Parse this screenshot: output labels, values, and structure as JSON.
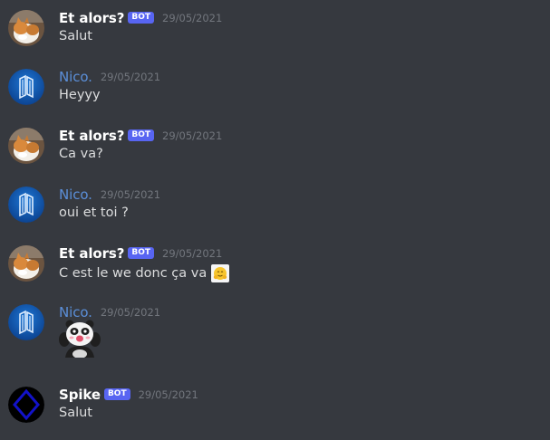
{
  "messages": [
    {
      "user": "Et alors?",
      "bot_tag": "BOT",
      "time": "29/05/2021",
      "text": "Salut"
    },
    {
      "user": "Nico.",
      "time": "29/05/2021",
      "text": "Heyyy"
    },
    {
      "user": "Et alors?",
      "bot_tag": "BOT",
      "time": "29/05/2021",
      "text": "Ca va?"
    },
    {
      "user": "Nico.",
      "time": "29/05/2021",
      "text": "oui et toi ?"
    },
    {
      "user": "Et alors?",
      "bot_tag": "BOT",
      "time": "29/05/2021",
      "text": "C est le we donc ça va",
      "emoji": "hugging-face-emoji"
    },
    {
      "user": "Nico.",
      "time": "29/05/2021",
      "sticker": "panda-sticker"
    },
    {
      "user": "Spike",
      "bot_tag": "BOT",
      "time": "29/05/2021",
      "text": "Salut"
    }
  ],
  "colors": {
    "background": "#36393f",
    "bot_tag": "#5865f2",
    "nico_name": "#5b8fd9",
    "timestamp": "#72767d",
    "message_text": "#dcddde"
  }
}
